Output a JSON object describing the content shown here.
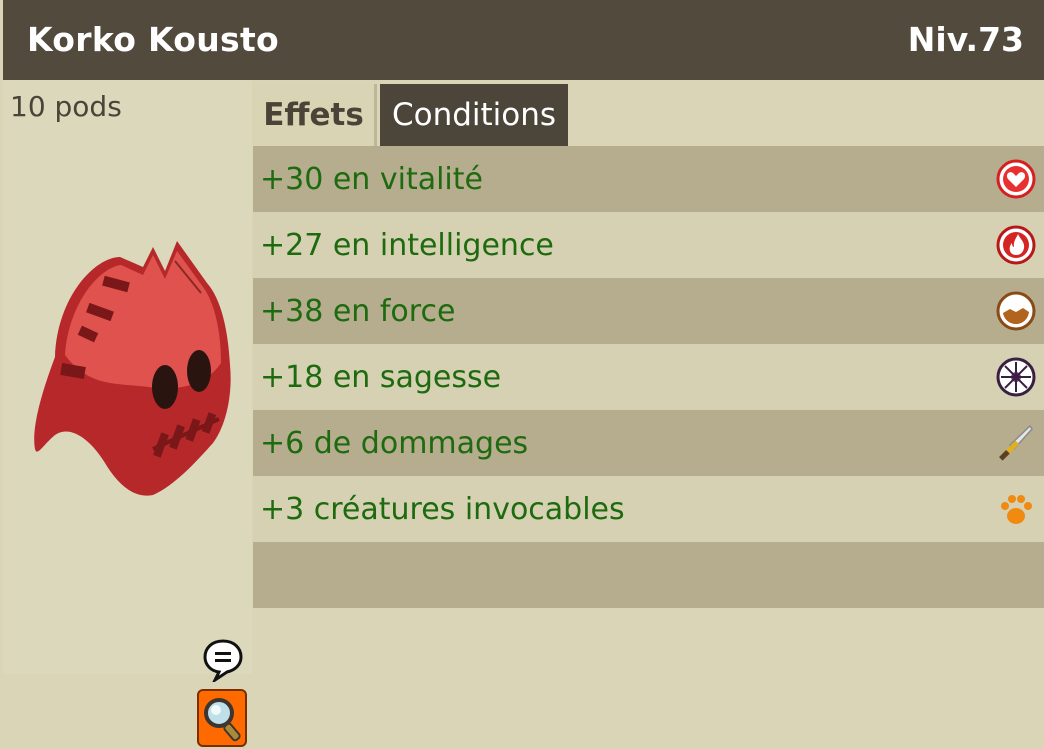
{
  "header": {
    "item_name": "Korko Kousto",
    "level": "Niv.73"
  },
  "item": {
    "weight": "10 pods",
    "image_icon": "red-hood-mask-icon"
  },
  "tabs": [
    {
      "label": "Effets",
      "active": true
    },
    {
      "label": "Conditions",
      "active": false
    }
  ],
  "effects": [
    {
      "text": "+30 en vitalité",
      "icon": "heart-icon"
    },
    {
      "text": "+27 en intelligence",
      "icon": "fire-icon"
    },
    {
      "text": "+38 en force",
      "icon": "earth-icon"
    },
    {
      "text": "+18 en sagesse",
      "icon": "wisdom-icon"
    },
    {
      "text": "+6 de dommages",
      "icon": "sword-icon"
    },
    {
      "text": "+3 créatures invocables",
      "icon": "paw-icon"
    }
  ],
  "colors": {
    "header_bg": "#524a3d",
    "effect_text": "#1e6a0f",
    "row_dark": "#b6ad8e",
    "row_light": "#d6d1b2"
  }
}
